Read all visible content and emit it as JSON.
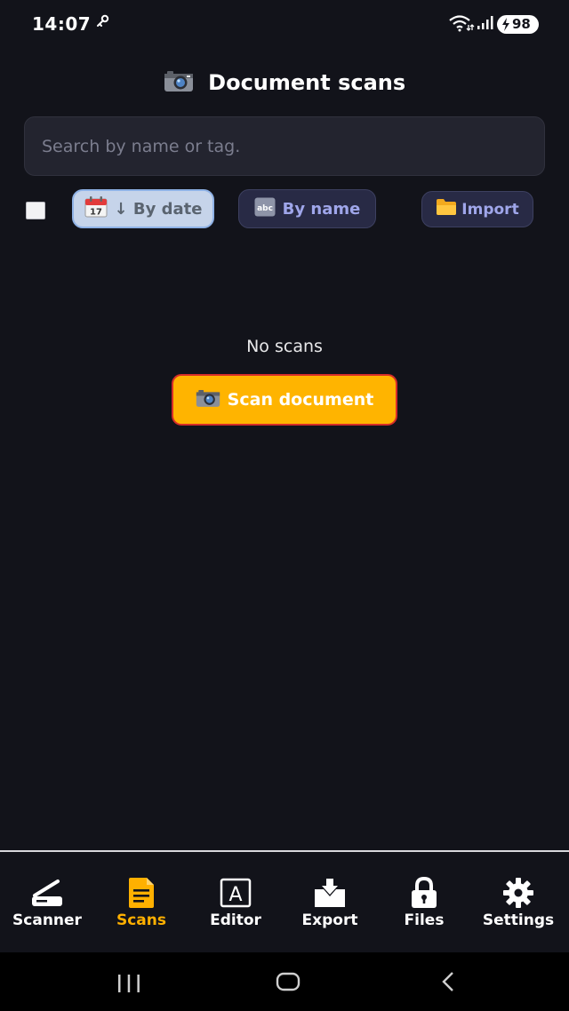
{
  "status_bar": {
    "time": "14:07",
    "battery": "98",
    "icons": [
      "key-icon",
      "wifi-icon",
      "signal-icon",
      "battery-charging-icon"
    ]
  },
  "header": {
    "icon": "camera-icon",
    "title": "Document scans"
  },
  "search": {
    "placeholder": "Search by name or tag.",
    "value": ""
  },
  "filters": {
    "select_all_checked": false,
    "sort_date": {
      "icon": "calendar-icon",
      "label": "↓ By date",
      "active": true
    },
    "sort_name": {
      "icon": "abc-icon",
      "label": "By name",
      "active": false
    },
    "import": {
      "icon": "folder-icon",
      "label": "Import"
    }
  },
  "empty_state": {
    "message": "No scans",
    "action_label": "Scan document",
    "action_icon": "camera-icon"
  },
  "bottom_nav": {
    "active": "Scans",
    "items": [
      {
        "label": "Scanner",
        "icon": "scanner-icon"
      },
      {
        "label": "Scans",
        "icon": "document-icon"
      },
      {
        "label": "Editor",
        "icon": "editor-icon"
      },
      {
        "label": "Export",
        "icon": "export-icon"
      },
      {
        "label": "Files",
        "icon": "lock-icon"
      },
      {
        "label": "Settings",
        "icon": "gear-icon"
      }
    ]
  },
  "system_nav": {
    "icons": [
      "recent-apps-icon",
      "home-icon",
      "back-icon"
    ]
  },
  "colors": {
    "background": "#12131a",
    "accent": "#ffb400",
    "accent_border": "#d62d28",
    "active_nav": "#ffb000",
    "chip_bg": "#282a45",
    "chip_text": "#9fa6ea",
    "search_bg": "#23242f"
  }
}
